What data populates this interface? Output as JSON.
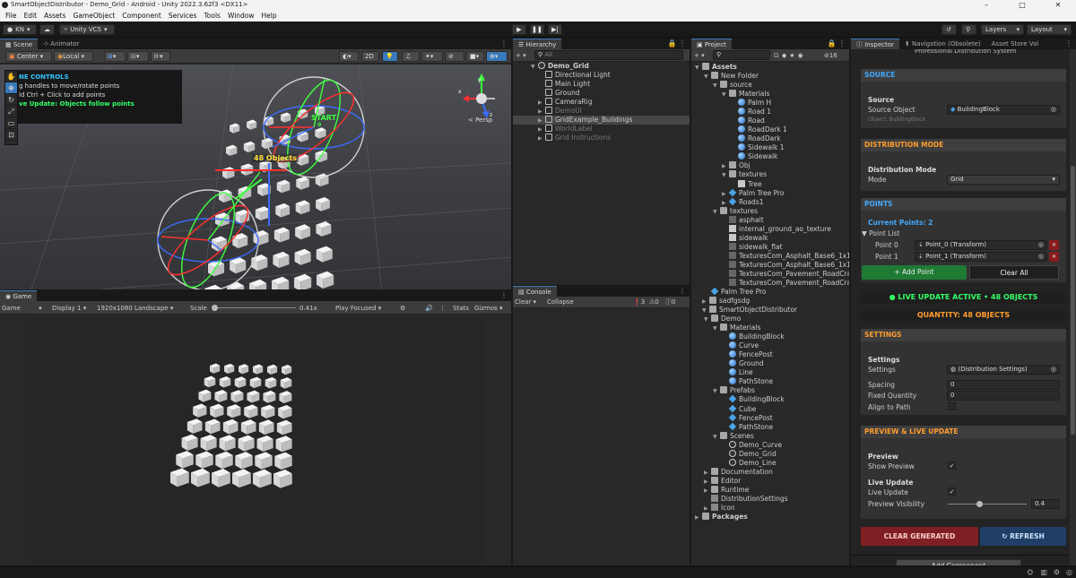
{
  "window": {
    "title": "SmartObjectDistributor - Demo_Grid - Android - Unity 2022.3.62f3 <DX11>"
  },
  "menu": [
    "File",
    "Edit",
    "Assets",
    "GameObject",
    "Component",
    "Services",
    "Tools",
    "Window",
    "Help"
  ],
  "toolbar": {
    "account": "KN",
    "vcs": "Unity VCS",
    "layers": "Layers",
    "layout": "Layout"
  },
  "scene": {
    "tab": "Scene",
    "tab2": "Animator",
    "pivot": "Center",
    "space": "Local",
    "mode2d": "2D",
    "overlay_title": "NE CONTROLS",
    "overlay_line1": "g handles to move/rotate points",
    "overlay_line2": "ld Ctrl + Click to add points",
    "overlay_line3": "ve Update: Objects follow points",
    "label_objects": "48 Objects",
    "label_start": "START",
    "label_start_sub": "0",
    "persp": "< Persp"
  },
  "game": {
    "tab": "Game",
    "display_label": "Game",
    "display": "Display 1",
    "resolution": "1920x1080 Landscape",
    "scale_label": "Scale",
    "scale_value": "0.41x",
    "play_mode": "Play Focused",
    "stats": "Stats",
    "gizmos": "Gizmos"
  },
  "hierarchy": {
    "tab": "Hierarchy",
    "search": "All",
    "root": "Demo_Grid",
    "items": [
      "Directional Light",
      "Main Light",
      "Ground",
      "CameraRig",
      "DemoUI",
      "GridExample_Buildings",
      "WorldLabel",
      "Grid Instructions"
    ]
  },
  "console": {
    "tab": "Console",
    "clear": "Clear",
    "collapse": "Collapse",
    "errors": "3",
    "warnings": "0",
    "logs": "0"
  },
  "project": {
    "tab": "Project",
    "count": "16",
    "tree": [
      {
        "d": 0,
        "t": "folder",
        "o": "open",
        "n": "Assets",
        "b": true
      },
      {
        "d": 1,
        "t": "folder",
        "o": "open",
        "n": "New Folder"
      },
      {
        "d": 2,
        "t": "folder",
        "o": "open",
        "n": "source"
      },
      {
        "d": 3,
        "t": "folder",
        "o": "open",
        "n": "Materials"
      },
      {
        "d": 4,
        "t": "mat",
        "n": "Palm H"
      },
      {
        "d": 4,
        "t": "mat",
        "n": "Road 1"
      },
      {
        "d": 4,
        "t": "mat",
        "n": "Road"
      },
      {
        "d": 4,
        "t": "mat",
        "n": "RoadDark 1"
      },
      {
        "d": 4,
        "t": "mat",
        "n": "RoadDark"
      },
      {
        "d": 4,
        "t": "mat",
        "n": "Sidewalk 1"
      },
      {
        "d": 4,
        "t": "mat",
        "n": "Sidewalk"
      },
      {
        "d": 3,
        "t": "folder",
        "o": "closed",
        "n": "Obj"
      },
      {
        "d": 3,
        "t": "folder",
        "o": "open",
        "n": "textures"
      },
      {
        "d": 4,
        "t": "tex",
        "n": "Tree"
      },
      {
        "d": 3,
        "t": "pref",
        "o": "closed",
        "n": "Palm Tree Pro"
      },
      {
        "d": 3,
        "t": "pref",
        "o": "closed",
        "n": "Roads1"
      },
      {
        "d": 2,
        "t": "folder",
        "o": "open",
        "n": "textures"
      },
      {
        "d": 3,
        "t": "texd",
        "n": "asphalt"
      },
      {
        "d": 3,
        "t": "tex",
        "n": "internal_ground_ao_texture"
      },
      {
        "d": 3,
        "t": "tex",
        "n": "sidewalk"
      },
      {
        "d": 3,
        "t": "texd",
        "n": "sidewalk_flat"
      },
      {
        "d": 3,
        "t": "texd",
        "n": "TexturesCom_Asphalt_Base6_1x1_512"
      },
      {
        "d": 3,
        "t": "texd",
        "n": "TexturesCom_Asphalt_Base6_1x1_512"
      },
      {
        "d": 3,
        "t": "texd",
        "n": "TexturesCom_Pavement_RoadCracks"
      },
      {
        "d": 3,
        "t": "texd",
        "n": "TexturesCom_Pavement_RoadCracks"
      },
      {
        "d": 1,
        "t": "pref",
        "n": "Palm Tree Pro"
      },
      {
        "d": 0,
        "t": "folder",
        "o": "closed",
        "n": "sadfgsdg",
        "x": 8
      },
      {
        "d": 0,
        "t": "folder",
        "o": "open",
        "n": "SmartObjectDistributor",
        "x": 8
      },
      {
        "d": 1,
        "t": "folder",
        "o": "open",
        "n": "Demo"
      },
      {
        "d": 2,
        "t": "folder",
        "o": "open",
        "n": "Materials"
      },
      {
        "d": 3,
        "t": "mat",
        "n": "BuildingBlock"
      },
      {
        "d": 3,
        "t": "mat",
        "n": "Curve"
      },
      {
        "d": 3,
        "t": "mat",
        "n": "FencePost"
      },
      {
        "d": 3,
        "t": "mat",
        "n": "Ground"
      },
      {
        "d": 3,
        "t": "mat",
        "n": "Line"
      },
      {
        "d": 3,
        "t": "mat",
        "n": "PathStone"
      },
      {
        "d": 2,
        "t": "folder",
        "o": "open",
        "n": "Prefabs"
      },
      {
        "d": 3,
        "t": "pref",
        "n": "BuildingBlock"
      },
      {
        "d": 3,
        "t": "pref",
        "n": "Cube"
      },
      {
        "d": 3,
        "t": "pref",
        "n": "FencePost"
      },
      {
        "d": 3,
        "t": "pref",
        "n": "PathStone"
      },
      {
        "d": 2,
        "t": "folder",
        "o": "open",
        "n": "Scenes"
      },
      {
        "d": 3,
        "t": "scene",
        "n": "Demo_Curve"
      },
      {
        "d": 3,
        "t": "scene",
        "n": "Demo_Grid"
      },
      {
        "d": 3,
        "t": "scene",
        "n": "Demo_Line"
      },
      {
        "d": 1,
        "t": "folder",
        "o": "closed",
        "n": "Documentation"
      },
      {
        "d": 1,
        "t": "folder",
        "o": "closed",
        "n": "Editor"
      },
      {
        "d": 1,
        "t": "folder",
        "o": "closed",
        "n": "Runtime"
      },
      {
        "d": 1,
        "t": "script",
        "n": "DistributionSettings"
      },
      {
        "d": 1,
        "t": "script",
        "o": "closed",
        "n": "Icon"
      },
      {
        "d": 0,
        "t": "folder",
        "o": "closed",
        "n": "Packages",
        "b": true
      }
    ]
  },
  "inspector": {
    "tabs": [
      "Inspector",
      "Navigation (Obsolete)",
      "Asset Store Val"
    ],
    "subtitle": "Professional Distribution System",
    "source": {
      "header": "SOURCE",
      "section": "Source",
      "label": "Source Object",
      "value": "BuildingBlock",
      "info": "Object: BuildingBlock"
    },
    "distribution": {
      "header": "DISTRIBUTION MODE",
      "section": "Distribution Mode",
      "label": "Mode",
      "value": "Grid"
    },
    "points": {
      "header": "POINTS",
      "current": "Current Points: 2",
      "list_label": "Point List",
      "items": [
        {
          "label": "Point 0",
          "value": "Point_0 (Transform)"
        },
        {
          "label": "Point 1",
          "value": "Point_1 (Transform)"
        }
      ],
      "add": "+ Add Point",
      "clear": "Clear All"
    },
    "live_status": "● LIVE UPDATE ACTIVE • 48 OBJECTS",
    "quantity_status": "QUANTITY: 48 OBJECTS",
    "settings": {
      "header": "SETTINGS",
      "section": "Settings",
      "settings_label": "Settings",
      "settings_value": "(Distribution Settings)",
      "spacing_label": "Spacing",
      "spacing_value": "0",
      "fixed_label": "Fixed Quantity",
      "fixed_value": "0",
      "align_label": "Align to Path"
    },
    "preview": {
      "header": "PREVIEW & LIVE UPDATE",
      "section_preview": "Preview",
      "show_preview": "Show Preview",
      "section_live": "Live Update",
      "live_update": "Live Update",
      "visibility_label": "Preview Visibility",
      "visibility_value": "0.4",
      "visibility_fraction": 0.4,
      "check": "✓"
    },
    "clear_generated": "CLEAR GENERATED",
    "refresh": "↻ REFRESH",
    "add_component": "Add Component"
  },
  "colors": {
    "accent": "#3a79bb",
    "green": "#33ff66",
    "orange": "#ff9d2e",
    "blue": "#44aaff",
    "clear_btn": "#7f1f23",
    "refresh_btn": "#1f3f66"
  }
}
